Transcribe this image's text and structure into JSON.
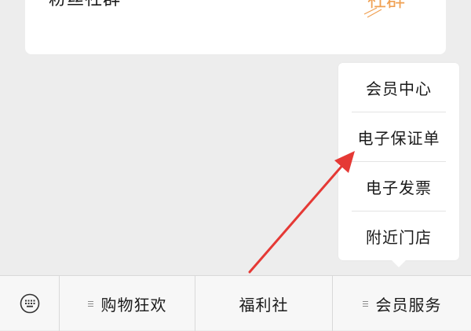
{
  "card": {
    "title": "粉丝社群",
    "logo_text": "社群",
    "logo_icon": "community-logo-icon",
    "accent_color": "#f0a052"
  },
  "popup_menu": {
    "items": [
      {
        "label": "会员中心"
      },
      {
        "label": "电子保证单"
      },
      {
        "label": "电子发票"
      },
      {
        "label": "附近门店"
      }
    ]
  },
  "annotation": {
    "color": "#e53935",
    "points_to": "电子保证单"
  },
  "bottom_bar": {
    "keyboard_icon": "keyboard-icon",
    "tabs": [
      {
        "label": "购物狂欢",
        "has_submenu": true
      },
      {
        "label": "福利社",
        "has_submenu": false
      },
      {
        "label": "会员服务",
        "has_submenu": true
      }
    ]
  }
}
